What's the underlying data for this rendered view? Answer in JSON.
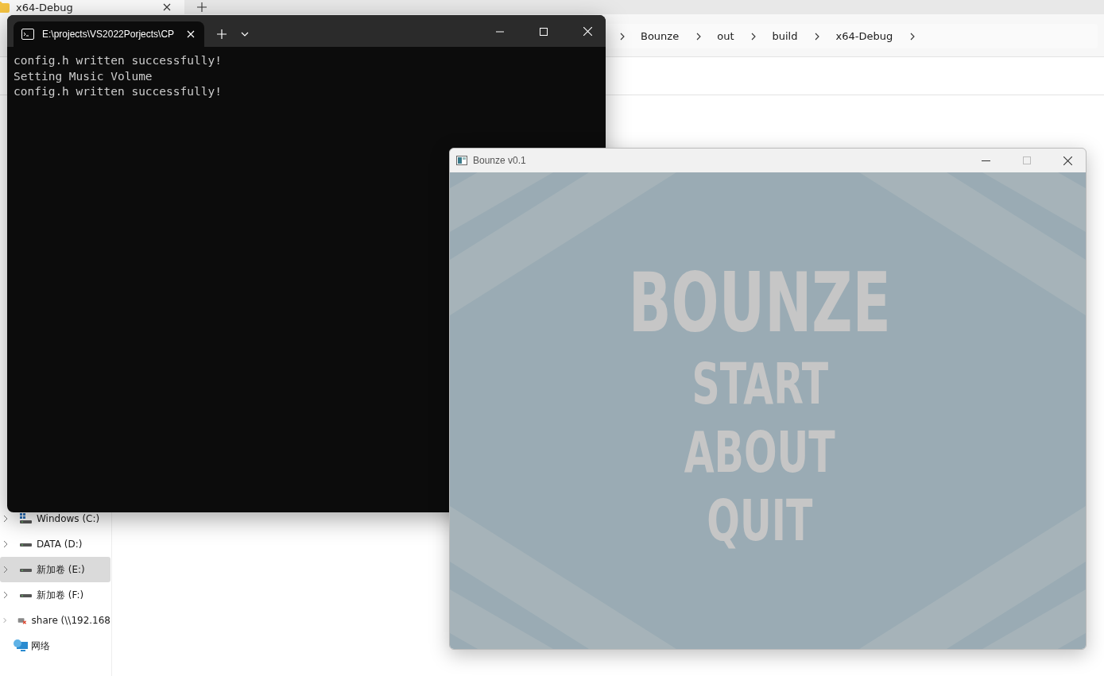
{
  "explorer": {
    "tabs": [
      {
        "label": "x64-Debug",
        "selected": true
      }
    ],
    "breadcrumbs": [
      "Bounze",
      "out",
      "build",
      "x64-Debug"
    ],
    "sidebar": {
      "items": [
        {
          "label": "Windows (C:)",
          "kind": "system-drive",
          "selected": false
        },
        {
          "label": "DATA (D:)",
          "kind": "drive",
          "selected": false
        },
        {
          "label": "新加卷 (E:)",
          "kind": "drive",
          "selected": true
        },
        {
          "label": "新加卷 (F:)",
          "kind": "drive",
          "selected": false
        },
        {
          "label": "share (\\\\192.168",
          "kind": "network-drive",
          "selected": false
        },
        {
          "label": "网络",
          "kind": "network",
          "selected": false
        }
      ]
    }
  },
  "terminal": {
    "tab_title": "E:\\projects\\VS2022Porjects\\CP",
    "lines": [
      "config.h written successfully!",
      "Setting Music Volume",
      "config.h written successfully!"
    ]
  },
  "game": {
    "title": "Bounze v0.1",
    "logo": "BOUNZE",
    "menu": [
      "START",
      "ABOUT",
      "QUIT"
    ]
  }
}
